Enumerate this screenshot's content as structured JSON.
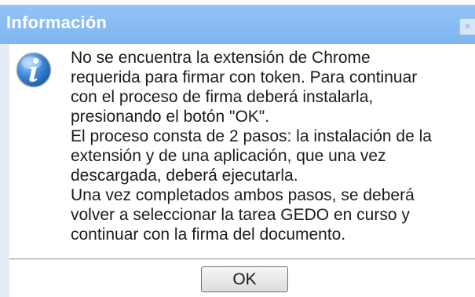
{
  "dialog": {
    "title": "Información",
    "close_symbol": "×",
    "icon": "info-icon",
    "message_lines": [
      "No se encuentra la extensión de Chrome",
      "requerida para firmar con token. Para continuar",
      "con el proceso de firma deberá instalarla,",
      "presionando el botón \"OK\".",
      "El proceso consta de 2 pasos: la instalación de la",
      "extensión y de una aplicación, que una vez",
      "descargada, deberá ejecutarla.",
      "Una vez completados ambos pasos, se deberá",
      "volver a seleccionar la tarea GEDO en curso y",
      "continuar con la firma del documento."
    ],
    "ok_label": "OK"
  },
  "colors": {
    "titlebar": "#85b9f1",
    "frame": "#e4ecf5",
    "icon_blue": "#2f74c0"
  }
}
